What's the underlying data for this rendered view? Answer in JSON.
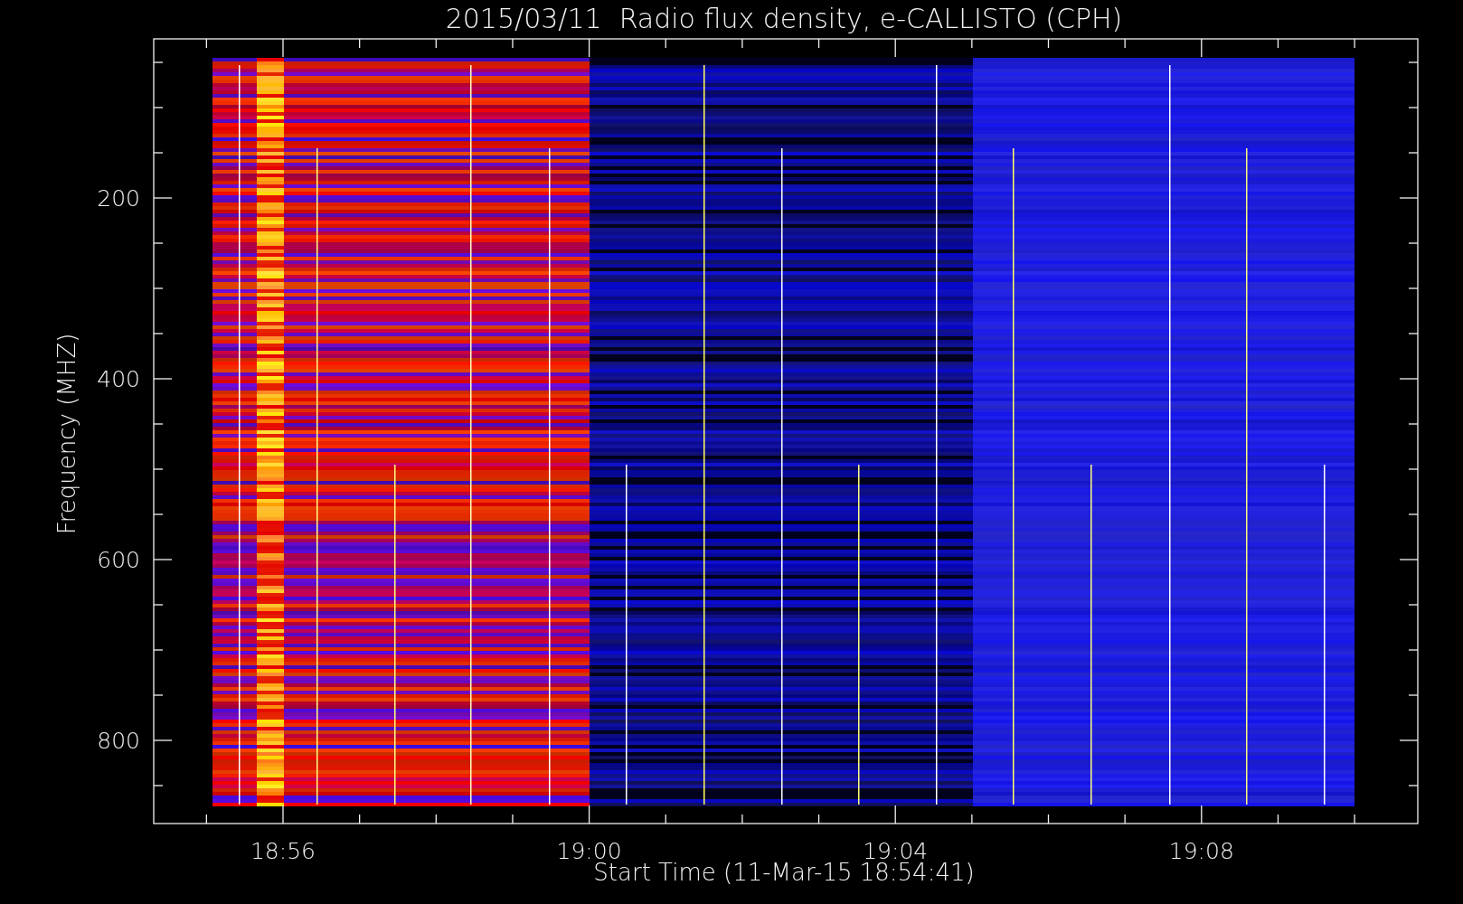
{
  "plot": {
    "title": "2015/03/11  Radio flux density, e-CALLISTO (CPH)",
    "xlabel": "Start Time (11-Mar-15 18:54:41)",
    "ylabel": "Frequency (MHZ)",
    "xticks": [
      "18:56",
      "19:00",
      "19:04",
      "19:08"
    ],
    "yticks": [
      "200",
      "400",
      "600",
      "800"
    ]
  }
}
